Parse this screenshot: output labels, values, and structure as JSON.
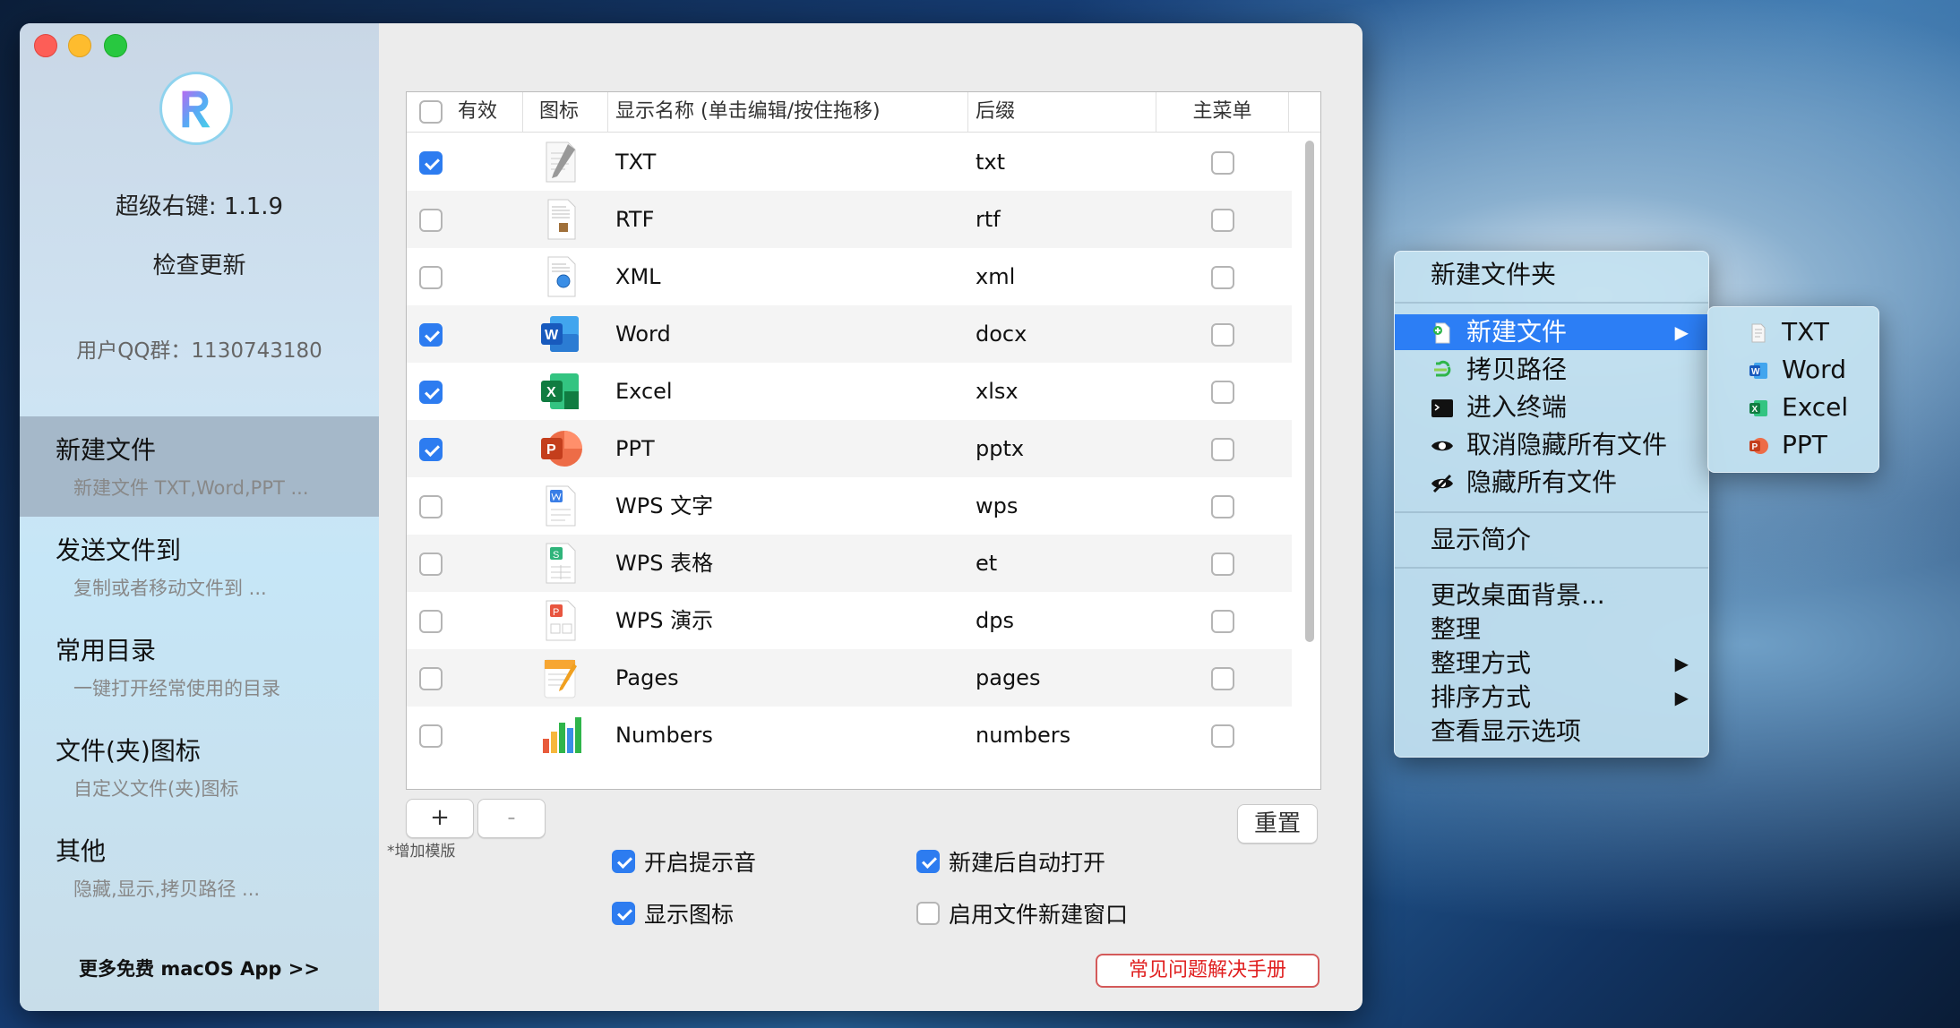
{
  "window": {
    "app_version": "超级右键: 1.1.9",
    "check_update": "检查更新",
    "qq_group": "用户QQ群：1130743180",
    "more_apps": "更多免费 macOS App >>",
    "nav": [
      {
        "title": "新建文件",
        "subtitle": "新建文件 TXT,Word,PPT ...",
        "active": true
      },
      {
        "title": "发送文件到",
        "subtitle": "复制或者移动文件到 ...",
        "active": false
      },
      {
        "title": "常用目录",
        "subtitle": "一键打开经常使用的目录",
        "active": false
      },
      {
        "title": "文件(夹)图标",
        "subtitle": "自定义文件(夹)图标",
        "active": false
      },
      {
        "title": "其他",
        "subtitle": "隐藏,显示,拷贝路径 ...",
        "active": false
      }
    ]
  },
  "table": {
    "headers": {
      "enabled": "有效",
      "icon": "图标",
      "name": "显示名称 (单击编辑/按住拖移)",
      "suffix": "后缀",
      "main_menu": "主菜单"
    },
    "rows": [
      {
        "enabled": true,
        "icon": "txt-file-icon",
        "name": "TXT",
        "suffix": "txt",
        "main_menu": false
      },
      {
        "enabled": false,
        "icon": "rtf-file-icon",
        "name": "RTF",
        "suffix": "rtf",
        "main_menu": false
      },
      {
        "enabled": false,
        "icon": "xml-file-icon",
        "name": "XML",
        "suffix": "xml",
        "main_menu": false
      },
      {
        "enabled": true,
        "icon": "word-icon",
        "name": "Word",
        "suffix": "docx",
        "main_menu": false
      },
      {
        "enabled": true,
        "icon": "excel-icon",
        "name": "Excel",
        "suffix": "xlsx",
        "main_menu": false
      },
      {
        "enabled": true,
        "icon": "ppt-icon",
        "name": "PPT",
        "suffix": "pptx",
        "main_menu": false
      },
      {
        "enabled": false,
        "icon": "wps-writer-icon",
        "name": "WPS 文字",
        "suffix": "wps",
        "main_menu": false
      },
      {
        "enabled": false,
        "icon": "wps-sheet-icon",
        "name": "WPS 表格",
        "suffix": "et",
        "main_menu": false
      },
      {
        "enabled": false,
        "icon": "wps-presentation-icon",
        "name": "WPS 演示",
        "suffix": "dps",
        "main_menu": false
      },
      {
        "enabled": false,
        "icon": "pages-icon",
        "name": "Pages",
        "suffix": "pages",
        "main_menu": false
      },
      {
        "enabled": false,
        "icon": "numbers-icon",
        "name": "Numbers",
        "suffix": "numbers",
        "main_menu": false
      }
    ]
  },
  "controls": {
    "add_label": "+",
    "remove_label": "-",
    "add_template_hint": "*增加模版",
    "reset_label": "重置",
    "options": [
      {
        "label": "开启提示音",
        "checked": true
      },
      {
        "label": "新建后自动打开",
        "checked": true
      },
      {
        "label": "显示图标",
        "checked": true
      },
      {
        "label": "启用文件新建窗口",
        "checked": false
      }
    ],
    "faq_label": "常见问题解决手册"
  },
  "context_menu": {
    "new_folder": "新建文件夹",
    "new_file": "新建文件",
    "copy_path": "拷贝路径",
    "open_terminal": "进入终端",
    "unhide_all": "取消隐藏所有文件",
    "hide_all": "隐藏所有文件",
    "get_info": "显示简介",
    "change_background": "更改桌面背景...",
    "clean_up": "整理",
    "clean_up_by": "整理方式",
    "sort_by": "排序方式",
    "show_view_options": "查看显示选项",
    "arrow": "▶",
    "submenu": [
      "TXT",
      "Word",
      "Excel",
      "PPT"
    ]
  },
  "colors": {
    "accent": "#2c7ef5",
    "checkbox_on": "#2d7cf0",
    "faq_red": "#e02020"
  }
}
